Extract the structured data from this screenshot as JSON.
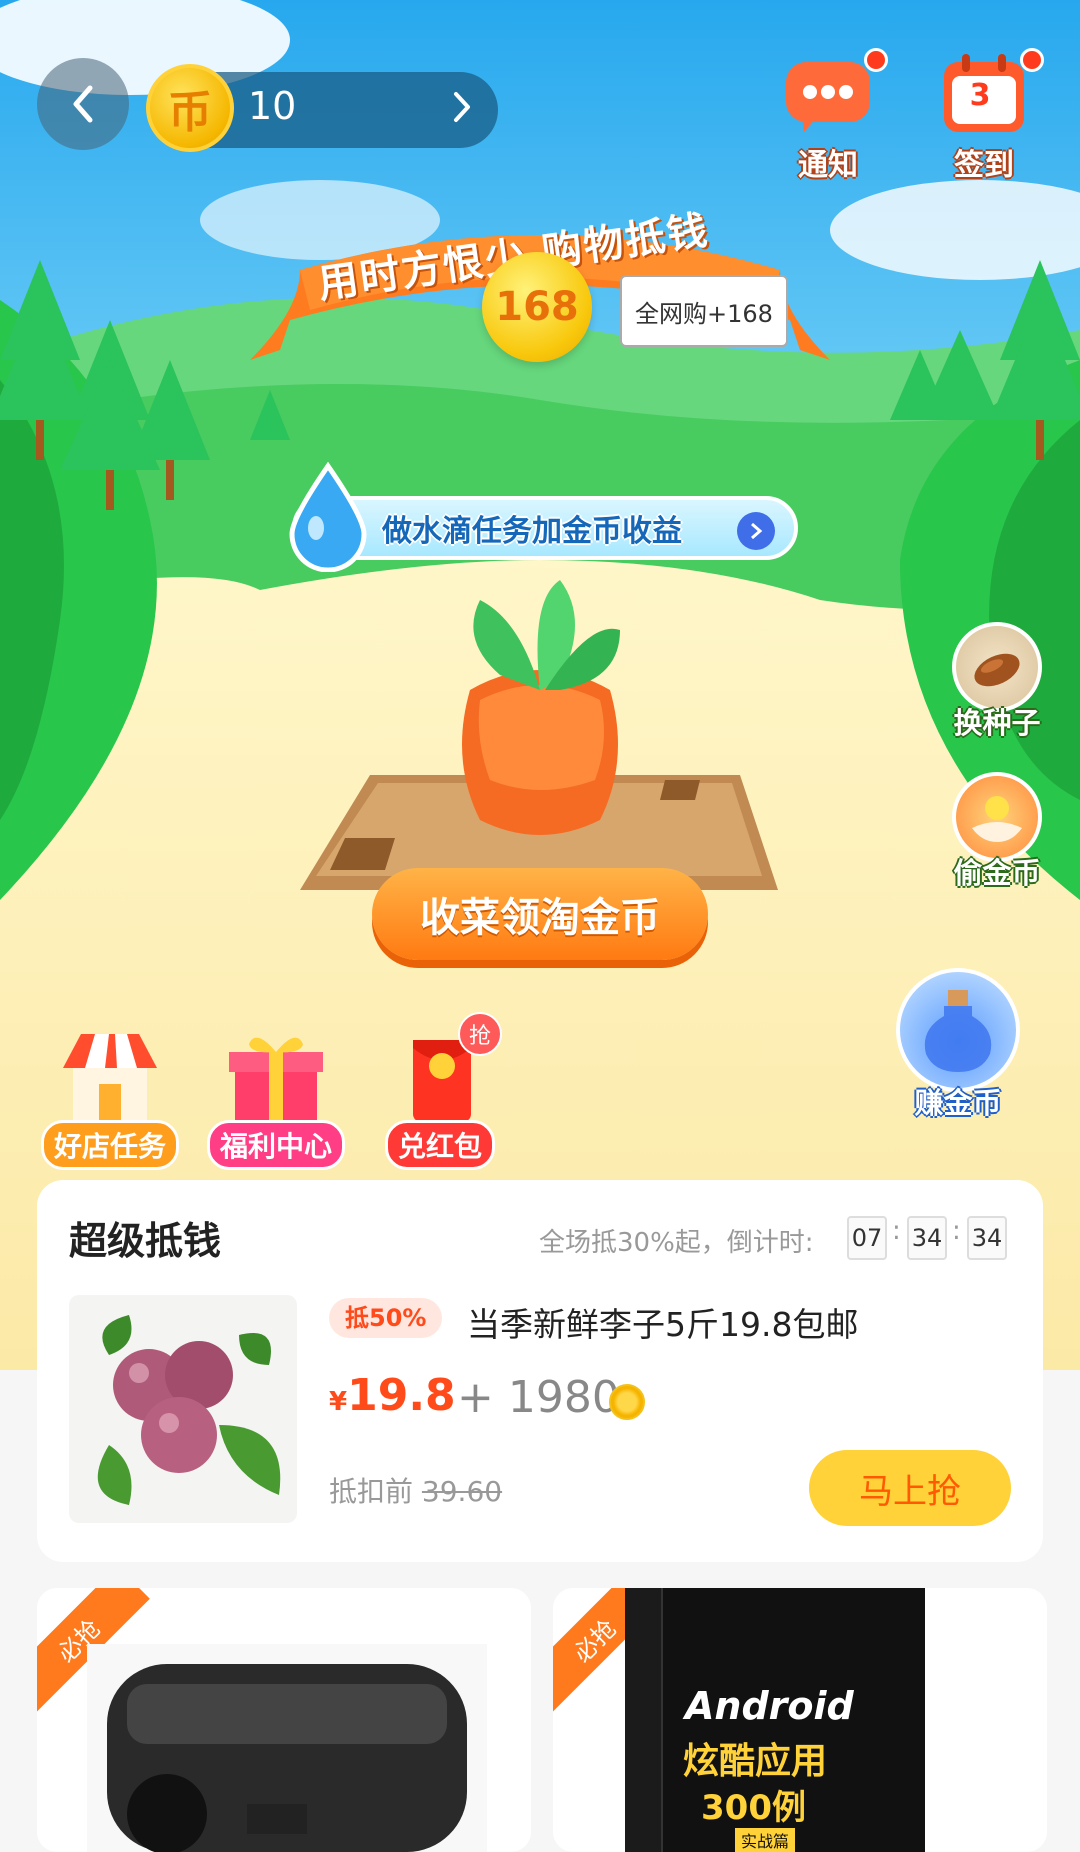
{
  "header": {
    "coin_count": "10",
    "notify_label": "通知",
    "checkin_label": "签到",
    "checkin_day": "3"
  },
  "banner": {
    "text": "用时方恨少 购物抵钱",
    "coin_value": "168",
    "tip": "全网购+168"
  },
  "water_task": {
    "label": "做水滴任务加金币收益"
  },
  "harvest_button": "收菜领淘金币",
  "side_actions": {
    "change_seed": "换种子",
    "steal_coins": "偷金币",
    "earn_coins": "赚金币"
  },
  "tasks": [
    {
      "label": "好店任务"
    },
    {
      "label": "福利中心"
    },
    {
      "label": "兑红包",
      "badge": "抢"
    }
  ],
  "super_deal": {
    "title": "超级抵钱",
    "subtitle": "全场抵30%起，倒计时:",
    "timer": [
      "07",
      "34",
      "34"
    ],
    "product": {
      "discount_badge": "抵50%",
      "name": "当季新鲜李子5斤19.8包邮",
      "price_symbol": "¥",
      "price": "19.8",
      "coins": "+ 1980",
      "original_label": "抵扣前",
      "original_price": "39.60",
      "buy_button": "马上抢"
    }
  },
  "product_cards": [
    {
      "ribbon": "必抢"
    },
    {
      "ribbon": "必抢",
      "book_title": "Android",
      "book_subtitle": "炫酷应用",
      "book_count": "300例",
      "book_tag": "实战篇"
    }
  ],
  "colors": {
    "sky": "#3db9f0",
    "grass": "#2fd052",
    "path": "#fbecb0",
    "accent_orange": "#ff7a12",
    "price_red": "#ff4a1a",
    "buy_yellow": "#ffd23a"
  }
}
